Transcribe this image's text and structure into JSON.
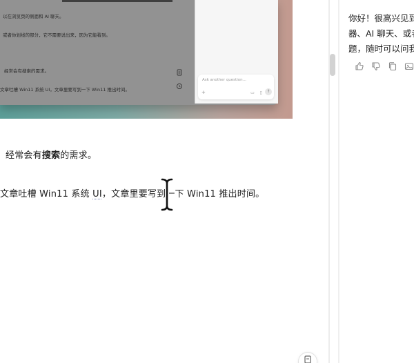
{
  "embedded_screenshot": {
    "line_1": "以在浏览页的侧面和 AI 聊天。",
    "line_2": "或者你划线的部分，它不需要说出来，因为它能看到。",
    "line_3": "经常会有搜索的需求。",
    "line_4": "文章吐槽 Win11 系统 UI，文章里要写到一下 Win11 推出时间。",
    "chat_input_placeholder": "Ask another question..."
  },
  "article": {
    "para_1_prefix": "经常会有",
    "para_1_bold": "搜索",
    "para_1_suffix": "的需求。",
    "para_2_start": "文章吐槽 Win11 系统 ",
    "para_2_ui": "UI",
    "para_2_end": "，文章里要写到一下 Win11 推出时间。"
  },
  "chat_panel": {
    "message_lines": [
      "你好！很高兴见到",
      "器、AI 聊天、或者",
      "题，随时可以问我"
    ],
    "actions": [
      {
        "name": "thumbs-up-icon"
      },
      {
        "name": "thumbs-down-icon"
      },
      {
        "name": "copy-icon"
      },
      {
        "name": "image-icon"
      }
    ]
  },
  "colors": {
    "accent_text": "#1f1f1f",
    "gradient_left": "#5c9e98",
    "gradient_right": "#c39a8f"
  }
}
